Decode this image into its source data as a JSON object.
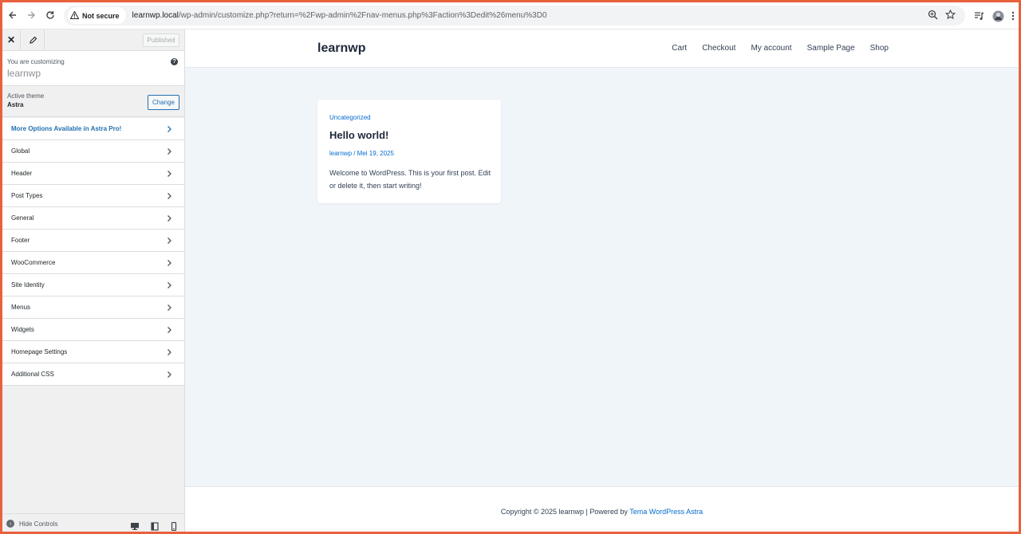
{
  "browser": {
    "security_label": "Not secure",
    "url_host": "learnwp.local",
    "url_path": "/wp-admin/customize.php?return=%2Fwp-admin%2Fnav-menus.php%3Faction%3Dedit%26menu%3D0"
  },
  "customizer": {
    "published_label": "Published",
    "customizing_label": "You are customizing",
    "site_name": "learnwp",
    "active_theme_label": "Active theme",
    "theme_name": "Astra",
    "change_label": "Change",
    "sections": [
      {
        "label": "More Options Available in Astra Pro!",
        "promo": true
      },
      {
        "label": "Global"
      },
      {
        "label": "Header"
      },
      {
        "label": "Post Types"
      },
      {
        "label": "General"
      },
      {
        "label": "Footer"
      },
      {
        "label": "WooCommerce"
      },
      {
        "label": "Site Identity"
      },
      {
        "label": "Menus"
      },
      {
        "label": "Widgets"
      },
      {
        "label": "Homepage Settings"
      },
      {
        "label": "Additional CSS"
      }
    ],
    "hide_controls_label": "Hide Controls"
  },
  "preview": {
    "site_title": "learnwp",
    "nav": [
      "Cart",
      "Checkout",
      "My account",
      "Sample Page",
      "Shop"
    ],
    "post": {
      "category": "Uncategorized",
      "title": "Hello world!",
      "meta": "learnwp / Mei 19, 2025",
      "excerpt": "Welcome to WordPress. This is your first post. Edit or delete it, then start writing!"
    },
    "footer": {
      "prefix": "Copyright © 2025 learnwp | Powered by ",
      "link": "Tema WordPress Astra"
    }
  },
  "colors": {
    "accent": "#046bd2",
    "wp_blue": "#2271b1",
    "frame_border": "#e8613c"
  },
  "icons": [
    "back-arrow-icon",
    "forward-arrow-icon",
    "reload-icon",
    "warning-icon",
    "zoom-icon",
    "star-icon",
    "media-queue-icon",
    "profile-avatar-icon",
    "kebab-menu-icon",
    "close-icon",
    "pencil-icon",
    "help-icon",
    "chevron-right-icon",
    "hide-controls-icon",
    "desktop-icon",
    "tablet-icon",
    "mobile-icon"
  ]
}
